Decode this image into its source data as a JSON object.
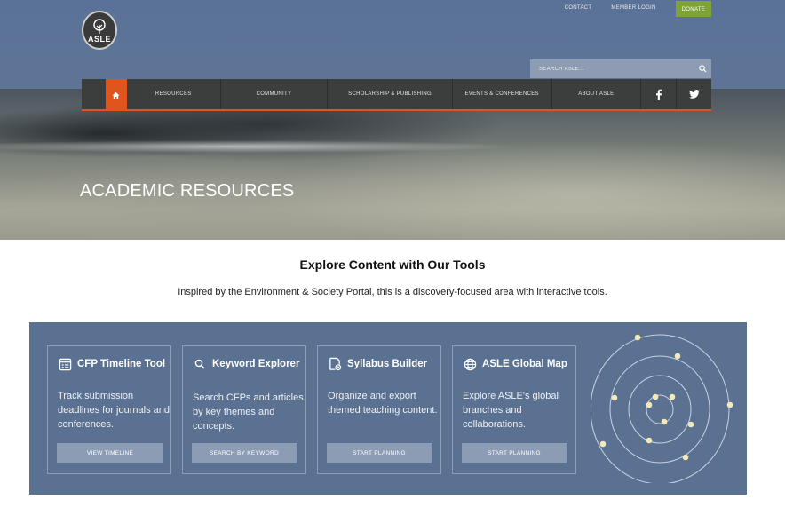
{
  "header": {
    "logo_text": "ASLE",
    "utility_links": [
      "CONTACT",
      "MEMBER LOGIN"
    ],
    "donate_label": "DONATE",
    "search_placeholder": "SEARCH ASLE..."
  },
  "nav": {
    "items": [
      "RESOURCES",
      "COMMUNITY",
      "SCHOLARSHIP & PUBLISHING",
      "EVENTS & CONFERENCES",
      "ABOUT ASLE"
    ],
    "accent_color": "#e0541d"
  },
  "hero": {
    "title": "ACADEMIC RESOURCES"
  },
  "intro": {
    "title": "Explore Content with Our Tools",
    "text": "Inspired by the Environment & Society Portal, this is a discovery-focused area with interactive tools."
  },
  "tools": [
    {
      "icon": "timeline-icon",
      "title": "CFP Timeline Tool",
      "desc": "Track submission deadlines for journals and conferences.",
      "button": "VIEW TIMELINE"
    },
    {
      "icon": "search-icon",
      "title": "Keyword Explorer",
      "desc": "Search CFPs and articles by key themes and concepts.",
      "button": "SEARCH BY KEYWORD"
    },
    {
      "icon": "syllabus-icon",
      "title": "Syllabus Builder",
      "desc": "Organize and export themed teaching content.",
      "button": "START PLANNING"
    },
    {
      "icon": "globe-icon",
      "title": "ASLE Global Map",
      "desc": "Explore ASLE's global branches and collaborations.",
      "button": "START PLANNING"
    }
  ],
  "colors": {
    "panel": "#5a7191",
    "button": "#8d9cb5",
    "donate": "#7ea33a",
    "nav": "#3c3d3d",
    "orbit_dot": "#f5e9b5"
  }
}
